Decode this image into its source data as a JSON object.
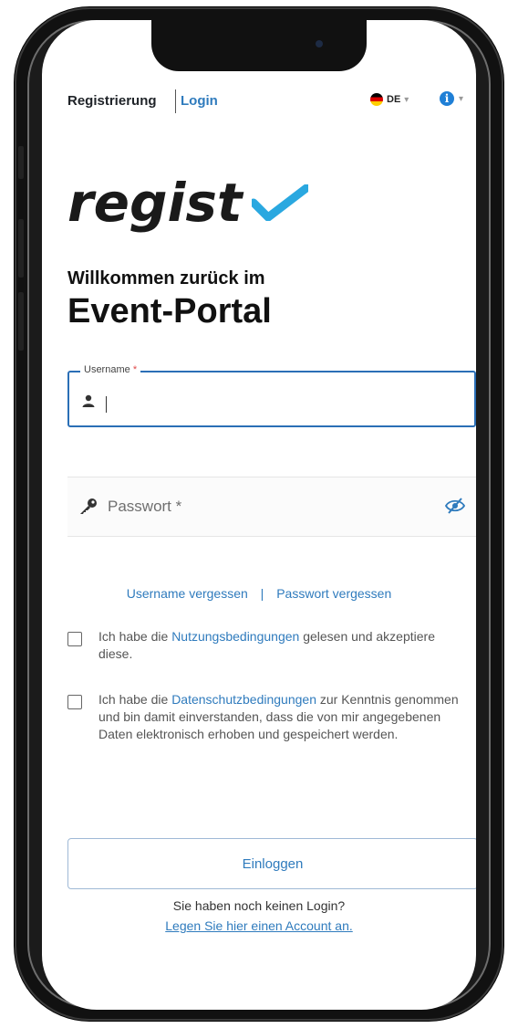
{
  "header": {
    "tab_register": "Registrierung",
    "tab_login": "Login",
    "language": "DE",
    "info_glyph": "i"
  },
  "logo": {
    "text": "regist",
    "check_color": "#2aa8e0"
  },
  "headline": {
    "line1": "Willkommen zurück im",
    "line2": "Event-Portal"
  },
  "form": {
    "username_label": "Username",
    "username_required": "*",
    "username_value": "",
    "password_placeholder": "Passwort *"
  },
  "links": {
    "forgot_username": "Username vergessen",
    "separator": "|",
    "forgot_password": "Passwort vergessen"
  },
  "consents": {
    "terms_prefix": "Ich habe die",
    "terms_link": "Nutzungsbedingungen",
    "terms_suffix": "gelesen und akzeptiere diese.",
    "privacy_prefix": "Ich habe die",
    "privacy_link": "Datenschutzbedingungen",
    "privacy_suffix": "zur Kenntnis genommen und bin damit einverstanden, dass die von mir angegebenen Daten elektronisch erhoben und gespeichert werden."
  },
  "actions": {
    "login_button": "Einloggen",
    "no_login_text": "Sie haben noch keinen Login?",
    "create_account_link": "Legen Sie hier einen Account an."
  },
  "colors": {
    "accent": "#2f7bbd",
    "required": "#e04848",
    "field_border": "#2b6fb6"
  }
}
